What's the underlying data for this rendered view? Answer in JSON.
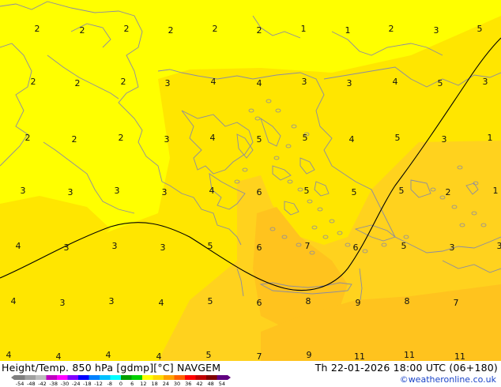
{
  "title": {
    "product": "Height/Temp. 850 hPa [gdmp][°C] NAVGEM",
    "valid_time": "Th 22-01-2026 18:00 UTC (06+180)"
  },
  "credit": "©weatheronline.co.uk",
  "colorbar": {
    "ticks": [
      "-54",
      "-48",
      "-42",
      "-38",
      "-30",
      "-24",
      "-18",
      "-12",
      "-8",
      "0",
      "6",
      "12",
      "18",
      "24",
      "30",
      "36",
      "42",
      "48",
      "54"
    ],
    "colors": [
      "#7f7f7f",
      "#a0a0a0",
      "#bdbdbd",
      "#c000c0",
      "#ff00ff",
      "#8000ff",
      "#0000ff",
      "#0080ff",
      "#00c0ff",
      "#00ffff",
      "#00a000",
      "#00d000",
      "#ffff00",
      "#ffd700",
      "#ffa000",
      "#ff6000",
      "#ff0000",
      "#c00000",
      "#800000",
      "#600080"
    ]
  },
  "field_colors": {
    "bright_yellow": "#ffff00",
    "gold": "#ffe600",
    "deep_gold": "#ffd21e",
    "orange": "#ffc31e",
    "coast": "#8c8ca0",
    "contour": "#000000"
  },
  "temperature_labels": [
    "2",
    "2",
    "2",
    "2",
    "2",
    "2",
    "1",
    "1",
    "2",
    "3",
    "5",
    "2",
    "2",
    "2",
    "3",
    "4",
    "4",
    "3",
    "3",
    "4",
    "5",
    "3",
    "2",
    "2",
    "2",
    "3",
    "4",
    "5",
    "5",
    "4",
    "5",
    "3",
    "1",
    "3",
    "3",
    "3",
    "3",
    "4",
    "6",
    "5",
    "5",
    "5",
    "2",
    "1",
    "4",
    "3",
    "3",
    "3",
    "5",
    "6",
    "7",
    "6",
    "5",
    "3",
    "3",
    "4",
    "3",
    "3",
    "4",
    "5",
    "6",
    "8",
    "9",
    "8",
    "7",
    "4",
    "4",
    "4",
    "4",
    "5",
    "7",
    "9",
    "11",
    "11",
    "11"
  ]
}
